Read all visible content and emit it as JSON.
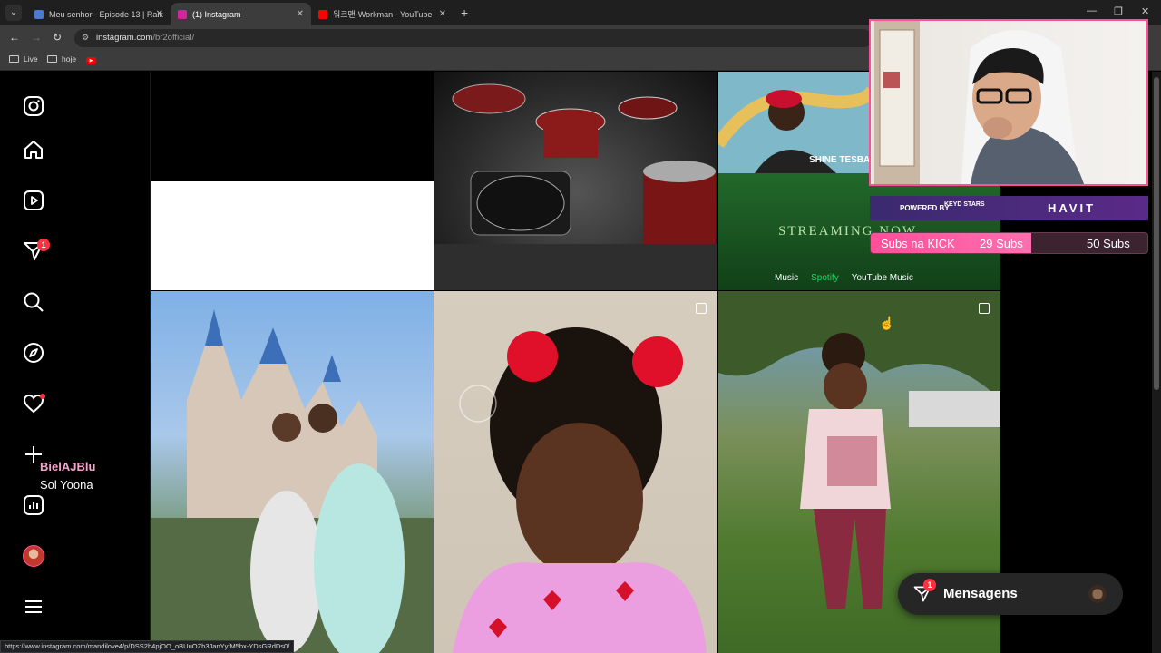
{
  "browser": {
    "tabs": [
      {
        "title": "Meu senhor - Episode 13 | Raik",
        "favicon_color": "#4a7bd0"
      },
      {
        "title": "(1) Instagram",
        "favicon_color": "#d6249f"
      },
      {
        "title": "워크맨-Workman - YouTube",
        "favicon_color": "#ff0000"
      }
    ],
    "url_host": "instagram.com",
    "url_path": "/br2official/",
    "bookmarks": [
      {
        "label": "Live",
        "icon": "folder-icon"
      },
      {
        "label": "hoje",
        "icon": "folder-icon"
      },
      {
        "label": "",
        "icon": "youtube-icon"
      }
    ],
    "status_url": "https://www.instagram.com/mandilove4/p/DSS2h4pjOO_oBUuOZb3JanYyfM5bx-YDsGRdDs0/"
  },
  "sidebar": {
    "notification_badge": "1",
    "overlay_names": [
      "BielAJBlu",
      "Sol Yoona"
    ]
  },
  "posts": [
    {
      "name": "post-black-white",
      "colors": [
        "#000000",
        "#ffffff"
      ]
    },
    {
      "name": "post-drum-kit",
      "colors": [
        "#3a3a3a",
        "#8b1a1a"
      ]
    },
    {
      "name": "post-streaming-now",
      "colors": [
        "#1f6b2a",
        "#54a84c"
      ]
    },
    {
      "name": "post-disney-couple",
      "colors": [
        "#8fb8e8",
        "#3a6b3a"
      ]
    },
    {
      "name": "post-girl-red-puffs",
      "colors": [
        "#d9cfc2",
        "#e8a0d0"
      ]
    },
    {
      "name": "post-girl-in-park",
      "colors": [
        "#6f9fd0",
        "#4f7a2e"
      ]
    }
  ],
  "streaming_post": {
    "headline": "STREAMING NOW",
    "platforms": [
      "Music",
      "Spotify",
      "YouTube Music"
    ],
    "shirt_text": "SHINE TESBABY"
  },
  "stream_overlay": {
    "powered_by": "POWERED BY",
    "sponsor_1": "KEYD STARS",
    "sponsor_2": "HAVIT",
    "subs_label": "Subs na KICK",
    "subs_current": "29 Subs",
    "subs_goal": "50 Subs",
    "subs_progress": 0.58
  },
  "messages": {
    "label": "Mensagens",
    "badge": "1"
  },
  "colors": {
    "accent_pink": "#ff4f9a",
    "badge_red": "#ff3040",
    "sponsor_purple": "#4a2a7e"
  }
}
